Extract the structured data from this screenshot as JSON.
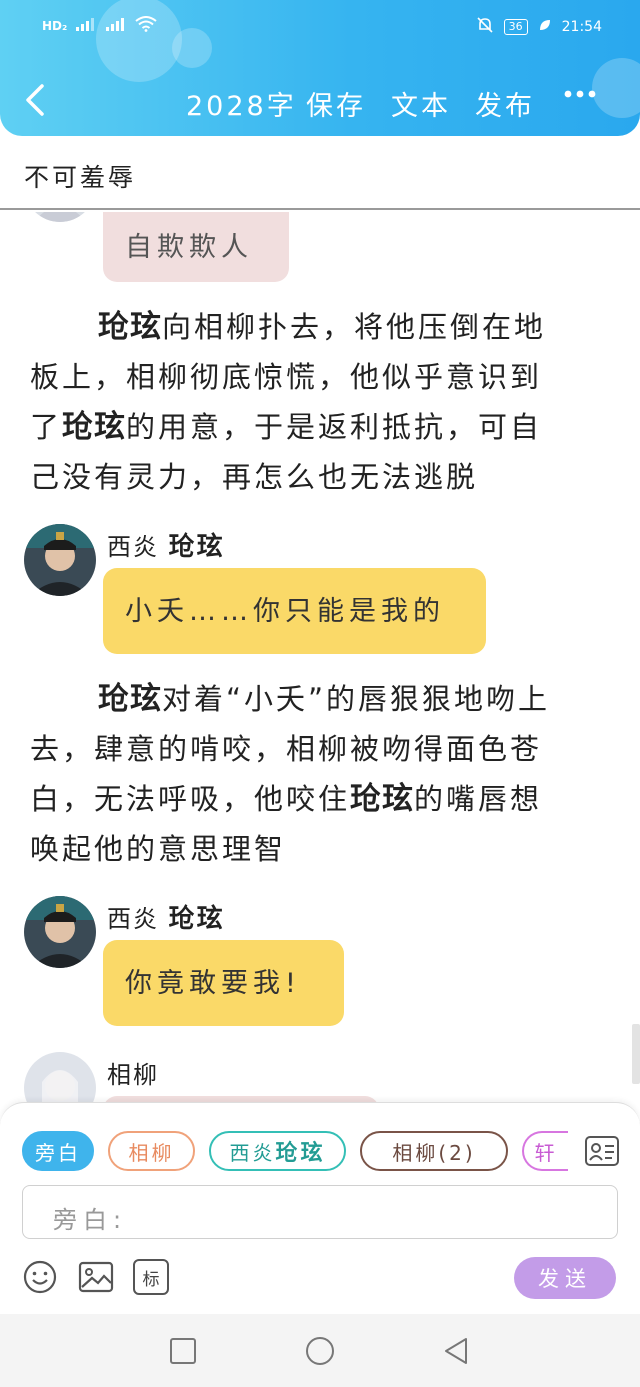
{
  "status_bar": {
    "left": [
      "HD₂",
      "⁴⁶",
      "⁴⁶"
    ],
    "battery": "36",
    "time": "21:54"
  },
  "toolbar": {
    "word_count": "2028字",
    "save_label": "保存",
    "text_label": "文本",
    "publish_label": "发布",
    "more_label": "•••"
  },
  "title": "不可羞辱",
  "messages": [
    {
      "text": "自欺欺人"
    },
    {
      "speaker_prefix": "西炎",
      "speaker_name": "玱玹",
      "text": "小夭……你只能是我的"
    },
    {
      "speaker_prefix": "西炎",
      "speaker_name": "玱玹",
      "text": "你竟敢要我!"
    },
    {
      "speaker_name": "相柳"
    }
  ],
  "narrations": [
    {
      "l1a": "玱玹",
      "l1b": "向相柳扑去，将他压倒在地",
      "l2": "板上，相柳彻底惊慌，他似乎意识到",
      "l3a": "了",
      "l3b": "玱玹",
      "l3c": "的用意，于是返利抵抗，可自",
      "l4": "己没有灵力，再怎么也无法逃脱"
    },
    {
      "l1a": "玱玹",
      "l1b": "对着“小夭”的唇狠狠地吻上",
      "l2": "去，肆意的啃咬，相柳被吻得面色苍",
      "l3a": "白，无法呼吸，他咬住",
      "l3b": "玱玹",
      "l3c": "的嘴唇想",
      "l4": "唤起他的意思理智"
    }
  ],
  "role_chips": [
    {
      "label": "旁白",
      "color": "#3fb4ec"
    },
    {
      "label": "相柳",
      "color": "#f0a27a"
    },
    {
      "label_prefix": "西炎",
      "label_name": "玱玹",
      "color": "#34bfb6"
    },
    {
      "label": "相柳(2)",
      "color": "#7a5448"
    },
    {
      "label": "轩",
      "color": "#d776e0"
    }
  ],
  "input": {
    "placeholder": "旁白:"
  },
  "tools": {
    "emoji_icon": "emoji-icon",
    "image_icon": "image-icon",
    "tag_label": "标"
  },
  "send_label": "发送",
  "colors": {
    "header": "#36b4f0",
    "bubble_pink": "#f1dede",
    "bubble_yellow": "#fad968",
    "send": "#c39ce8"
  }
}
